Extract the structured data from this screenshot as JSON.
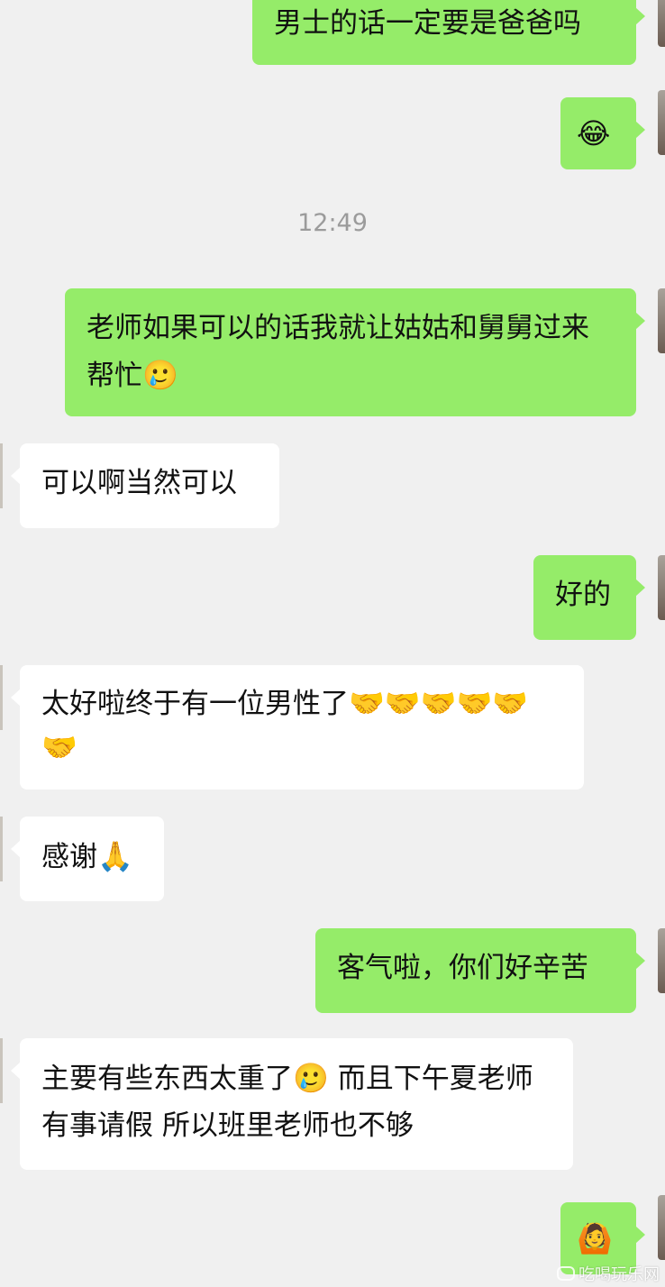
{
  "timestamp": "12:49",
  "messages": [
    {
      "side": "out",
      "text": "男士的话一定要是爸爸吗"
    },
    {
      "side": "out",
      "emoji": "😂"
    },
    {
      "side": "out",
      "text": "老师如果可以的话我就让姑姑和舅舅过来帮忙",
      "emoji": "🥲"
    },
    {
      "side": "in",
      "text": "可以啊当然可以"
    },
    {
      "side": "out",
      "text": "好的"
    },
    {
      "side": "in",
      "text": "太好啦终于有一位男性了",
      "emoji": "🤝🤝🤝🤝🤝🤝"
    },
    {
      "side": "in",
      "text": "感谢",
      "emoji": "🙏"
    },
    {
      "side": "out",
      "text": "客气啦，你们好辛苦"
    },
    {
      "side": "in",
      "text": "主要有些东西太重了",
      "emoji": "🥲",
      "text2": " 而且下午夏老师有事请假 所以班里老师也不够"
    },
    {
      "side": "out",
      "emoji": "🙆"
    }
  ],
  "watermark": "吃喝玩乐网"
}
